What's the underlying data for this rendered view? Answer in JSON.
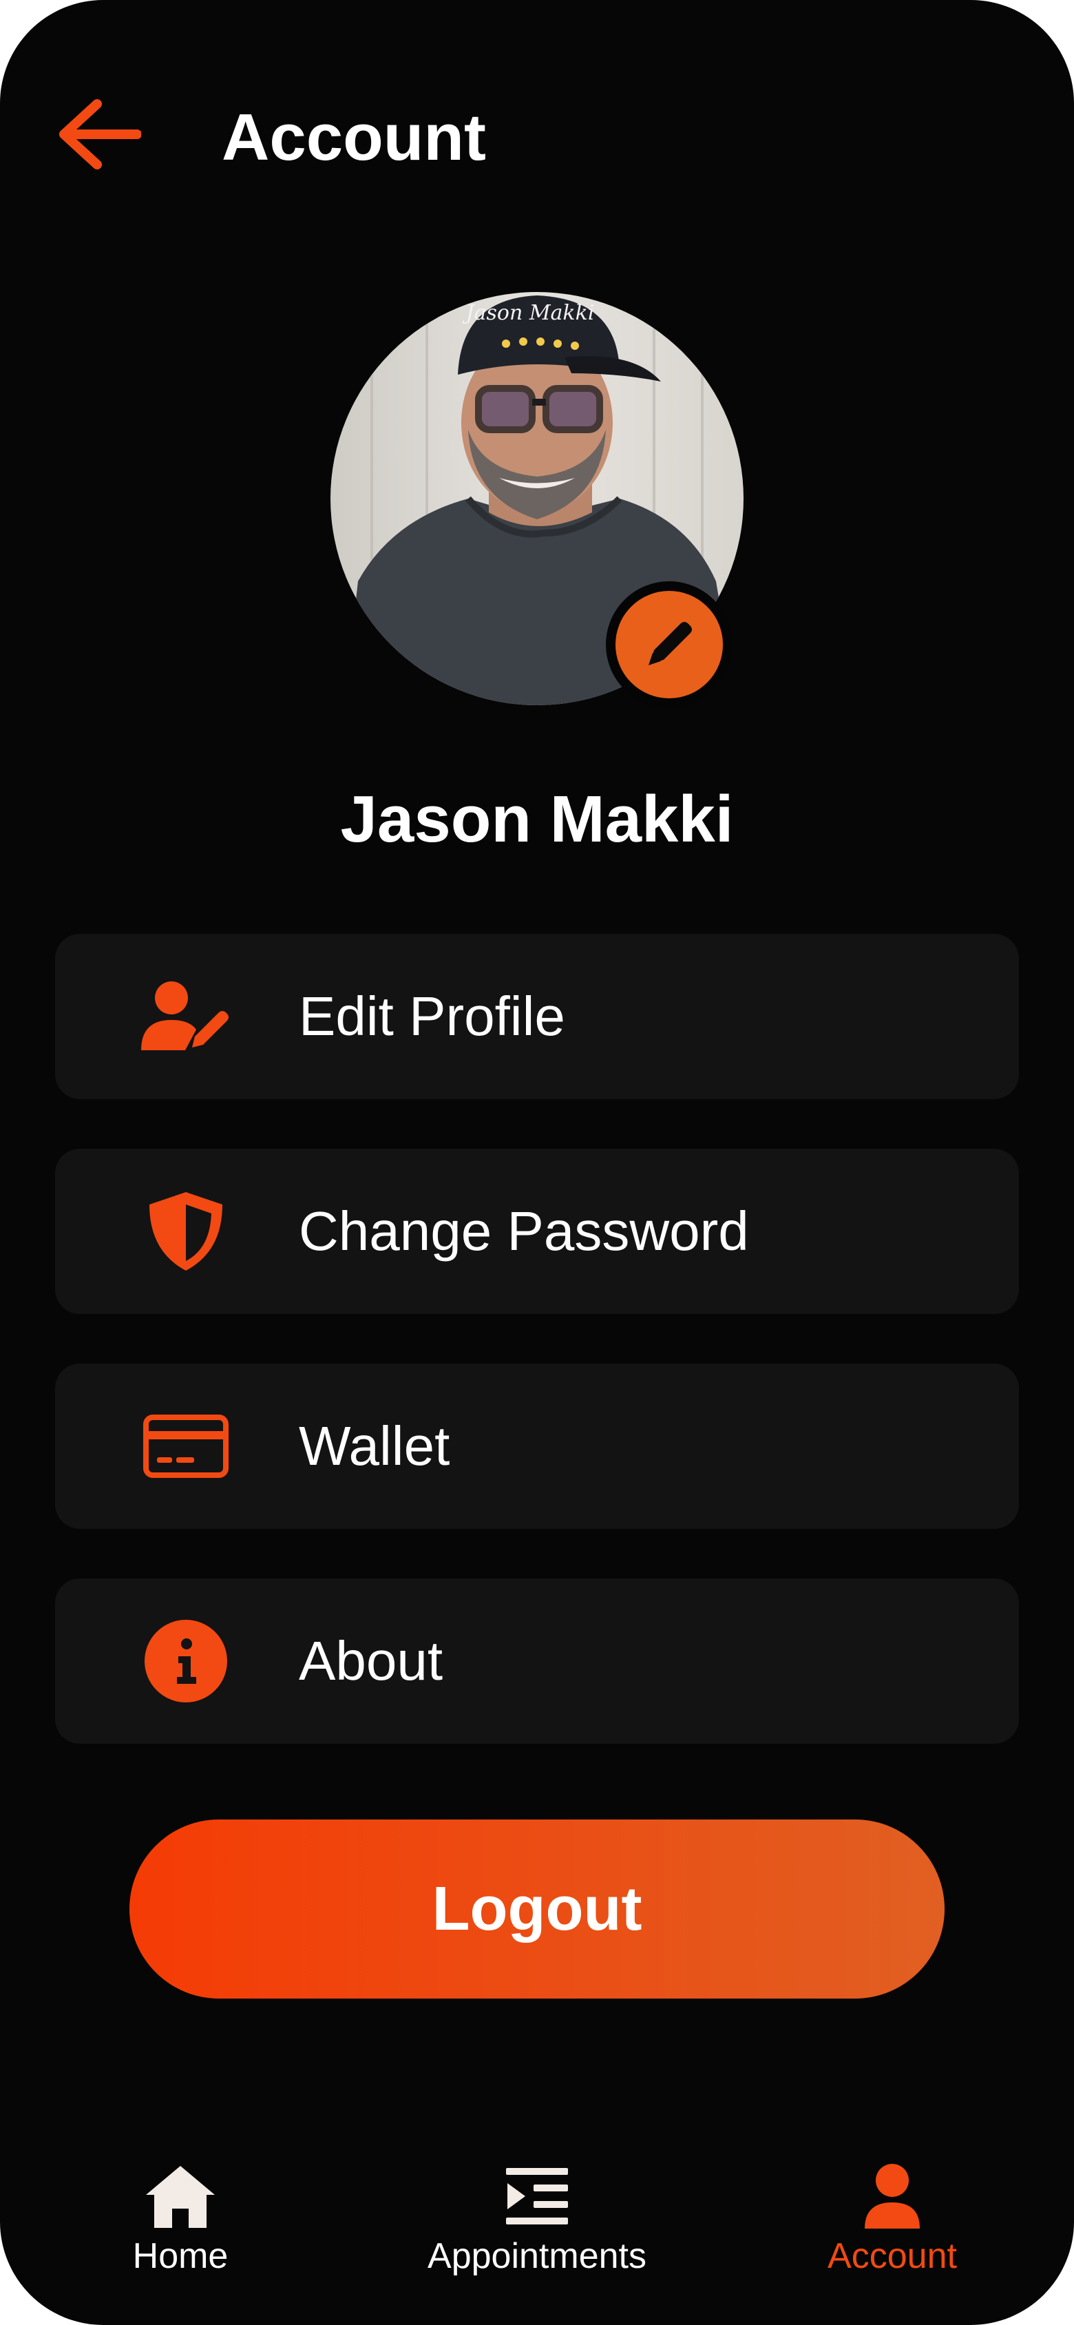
{
  "header": {
    "title": "Account",
    "back_icon": "arrow-left-icon"
  },
  "profile": {
    "name": "Jason Makki",
    "photo_cap_text": "Jason Makki",
    "edit_icon": "pencil-icon"
  },
  "menu": [
    {
      "label": "Edit Profile",
      "icon": "user-edit-icon"
    },
    {
      "label": "Change Password",
      "icon": "shield-icon"
    },
    {
      "label": "Wallet",
      "icon": "credit-card-icon"
    },
    {
      "label": "About",
      "icon": "info-icon"
    }
  ],
  "logout": {
    "label": "Logout"
  },
  "nav": [
    {
      "label": "Home",
      "icon": "home-icon",
      "active": false
    },
    {
      "label": "Appointments",
      "icon": "list-icon",
      "active": false
    },
    {
      "label": "Account",
      "icon": "person-icon",
      "active": true
    }
  ],
  "colors": {
    "accent": "#f24a12",
    "background": "#060606",
    "card": "#131313",
    "text": "#ffffff",
    "nav_inactive": "#f3ebe6"
  }
}
